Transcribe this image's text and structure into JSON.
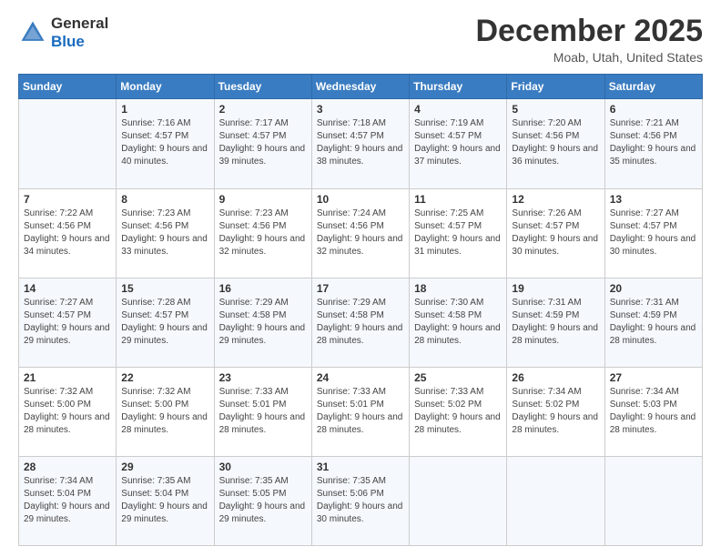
{
  "header": {
    "logo_general": "General",
    "logo_blue": "Blue",
    "month_title": "December 2025",
    "location": "Moab, Utah, United States"
  },
  "weekdays": [
    "Sunday",
    "Monday",
    "Tuesday",
    "Wednesday",
    "Thursday",
    "Friday",
    "Saturday"
  ],
  "weeks": [
    [
      {
        "day": "",
        "sunrise": "",
        "sunset": "",
        "daylight": ""
      },
      {
        "day": "1",
        "sunrise": "Sunrise: 7:16 AM",
        "sunset": "Sunset: 4:57 PM",
        "daylight": "Daylight: 9 hours and 40 minutes."
      },
      {
        "day": "2",
        "sunrise": "Sunrise: 7:17 AM",
        "sunset": "Sunset: 4:57 PM",
        "daylight": "Daylight: 9 hours and 39 minutes."
      },
      {
        "day": "3",
        "sunrise": "Sunrise: 7:18 AM",
        "sunset": "Sunset: 4:57 PM",
        "daylight": "Daylight: 9 hours and 38 minutes."
      },
      {
        "day": "4",
        "sunrise": "Sunrise: 7:19 AM",
        "sunset": "Sunset: 4:57 PM",
        "daylight": "Daylight: 9 hours and 37 minutes."
      },
      {
        "day": "5",
        "sunrise": "Sunrise: 7:20 AM",
        "sunset": "Sunset: 4:56 PM",
        "daylight": "Daylight: 9 hours and 36 minutes."
      },
      {
        "day": "6",
        "sunrise": "Sunrise: 7:21 AM",
        "sunset": "Sunset: 4:56 PM",
        "daylight": "Daylight: 9 hours and 35 minutes."
      }
    ],
    [
      {
        "day": "7",
        "sunrise": "Sunrise: 7:22 AM",
        "sunset": "Sunset: 4:56 PM",
        "daylight": "Daylight: 9 hours and 34 minutes."
      },
      {
        "day": "8",
        "sunrise": "Sunrise: 7:23 AM",
        "sunset": "Sunset: 4:56 PM",
        "daylight": "Daylight: 9 hours and 33 minutes."
      },
      {
        "day": "9",
        "sunrise": "Sunrise: 7:23 AM",
        "sunset": "Sunset: 4:56 PM",
        "daylight": "Daylight: 9 hours and 32 minutes."
      },
      {
        "day": "10",
        "sunrise": "Sunrise: 7:24 AM",
        "sunset": "Sunset: 4:56 PM",
        "daylight": "Daylight: 9 hours and 32 minutes."
      },
      {
        "day": "11",
        "sunrise": "Sunrise: 7:25 AM",
        "sunset": "Sunset: 4:57 PM",
        "daylight": "Daylight: 9 hours and 31 minutes."
      },
      {
        "day": "12",
        "sunrise": "Sunrise: 7:26 AM",
        "sunset": "Sunset: 4:57 PM",
        "daylight": "Daylight: 9 hours and 30 minutes."
      },
      {
        "day": "13",
        "sunrise": "Sunrise: 7:27 AM",
        "sunset": "Sunset: 4:57 PM",
        "daylight": "Daylight: 9 hours and 30 minutes."
      }
    ],
    [
      {
        "day": "14",
        "sunrise": "Sunrise: 7:27 AM",
        "sunset": "Sunset: 4:57 PM",
        "daylight": "Daylight: 9 hours and 29 minutes."
      },
      {
        "day": "15",
        "sunrise": "Sunrise: 7:28 AM",
        "sunset": "Sunset: 4:57 PM",
        "daylight": "Daylight: 9 hours and 29 minutes."
      },
      {
        "day": "16",
        "sunrise": "Sunrise: 7:29 AM",
        "sunset": "Sunset: 4:58 PM",
        "daylight": "Daylight: 9 hours and 29 minutes."
      },
      {
        "day": "17",
        "sunrise": "Sunrise: 7:29 AM",
        "sunset": "Sunset: 4:58 PM",
        "daylight": "Daylight: 9 hours and 28 minutes."
      },
      {
        "day": "18",
        "sunrise": "Sunrise: 7:30 AM",
        "sunset": "Sunset: 4:58 PM",
        "daylight": "Daylight: 9 hours and 28 minutes."
      },
      {
        "day": "19",
        "sunrise": "Sunrise: 7:31 AM",
        "sunset": "Sunset: 4:59 PM",
        "daylight": "Daylight: 9 hours and 28 minutes."
      },
      {
        "day": "20",
        "sunrise": "Sunrise: 7:31 AM",
        "sunset": "Sunset: 4:59 PM",
        "daylight": "Daylight: 9 hours and 28 minutes."
      }
    ],
    [
      {
        "day": "21",
        "sunrise": "Sunrise: 7:32 AM",
        "sunset": "Sunset: 5:00 PM",
        "daylight": "Daylight: 9 hours and 28 minutes."
      },
      {
        "day": "22",
        "sunrise": "Sunrise: 7:32 AM",
        "sunset": "Sunset: 5:00 PM",
        "daylight": "Daylight: 9 hours and 28 minutes."
      },
      {
        "day": "23",
        "sunrise": "Sunrise: 7:33 AM",
        "sunset": "Sunset: 5:01 PM",
        "daylight": "Daylight: 9 hours and 28 minutes."
      },
      {
        "day": "24",
        "sunrise": "Sunrise: 7:33 AM",
        "sunset": "Sunset: 5:01 PM",
        "daylight": "Daylight: 9 hours and 28 minutes."
      },
      {
        "day": "25",
        "sunrise": "Sunrise: 7:33 AM",
        "sunset": "Sunset: 5:02 PM",
        "daylight": "Daylight: 9 hours and 28 minutes."
      },
      {
        "day": "26",
        "sunrise": "Sunrise: 7:34 AM",
        "sunset": "Sunset: 5:02 PM",
        "daylight": "Daylight: 9 hours and 28 minutes."
      },
      {
        "day": "27",
        "sunrise": "Sunrise: 7:34 AM",
        "sunset": "Sunset: 5:03 PM",
        "daylight": "Daylight: 9 hours and 28 minutes."
      }
    ],
    [
      {
        "day": "28",
        "sunrise": "Sunrise: 7:34 AM",
        "sunset": "Sunset: 5:04 PM",
        "daylight": "Daylight: 9 hours and 29 minutes."
      },
      {
        "day": "29",
        "sunrise": "Sunrise: 7:35 AM",
        "sunset": "Sunset: 5:04 PM",
        "daylight": "Daylight: 9 hours and 29 minutes."
      },
      {
        "day": "30",
        "sunrise": "Sunrise: 7:35 AM",
        "sunset": "Sunset: 5:05 PM",
        "daylight": "Daylight: 9 hours and 29 minutes."
      },
      {
        "day": "31",
        "sunrise": "Sunrise: 7:35 AM",
        "sunset": "Sunset: 5:06 PM",
        "daylight": "Daylight: 9 hours and 30 minutes."
      },
      {
        "day": "",
        "sunrise": "",
        "sunset": "",
        "daylight": ""
      },
      {
        "day": "",
        "sunrise": "",
        "sunset": "",
        "daylight": ""
      },
      {
        "day": "",
        "sunrise": "",
        "sunset": "",
        "daylight": ""
      }
    ]
  ]
}
